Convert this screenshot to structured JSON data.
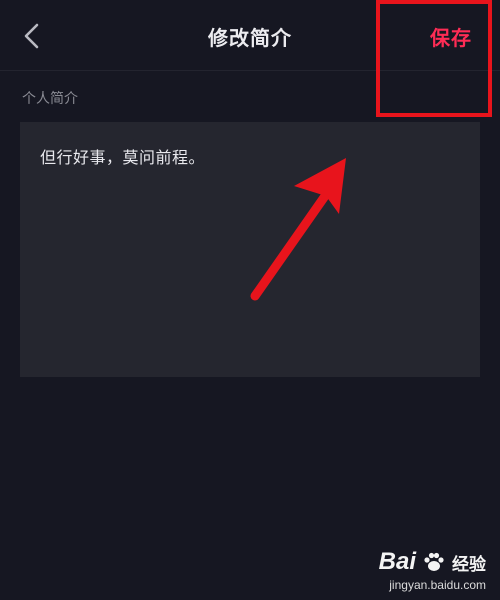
{
  "header": {
    "title": "修改简介",
    "save_label": "保存",
    "back_icon": "chevron-left-icon"
  },
  "bio": {
    "label": "个人简介",
    "value": "但行好事，莫问前程。"
  },
  "annotations": {
    "highlight_color": "#e8141c",
    "arrow_color": "#e8141c",
    "arrow_icon": "arrow-up-right-icon"
  },
  "watermark": {
    "brand": "Bai",
    "brand_suffix": "经验",
    "url": "jingyan.baidu.com"
  },
  "colors": {
    "background": "#161722",
    "accent": "#fe2c55",
    "field_background": "#25262f"
  }
}
